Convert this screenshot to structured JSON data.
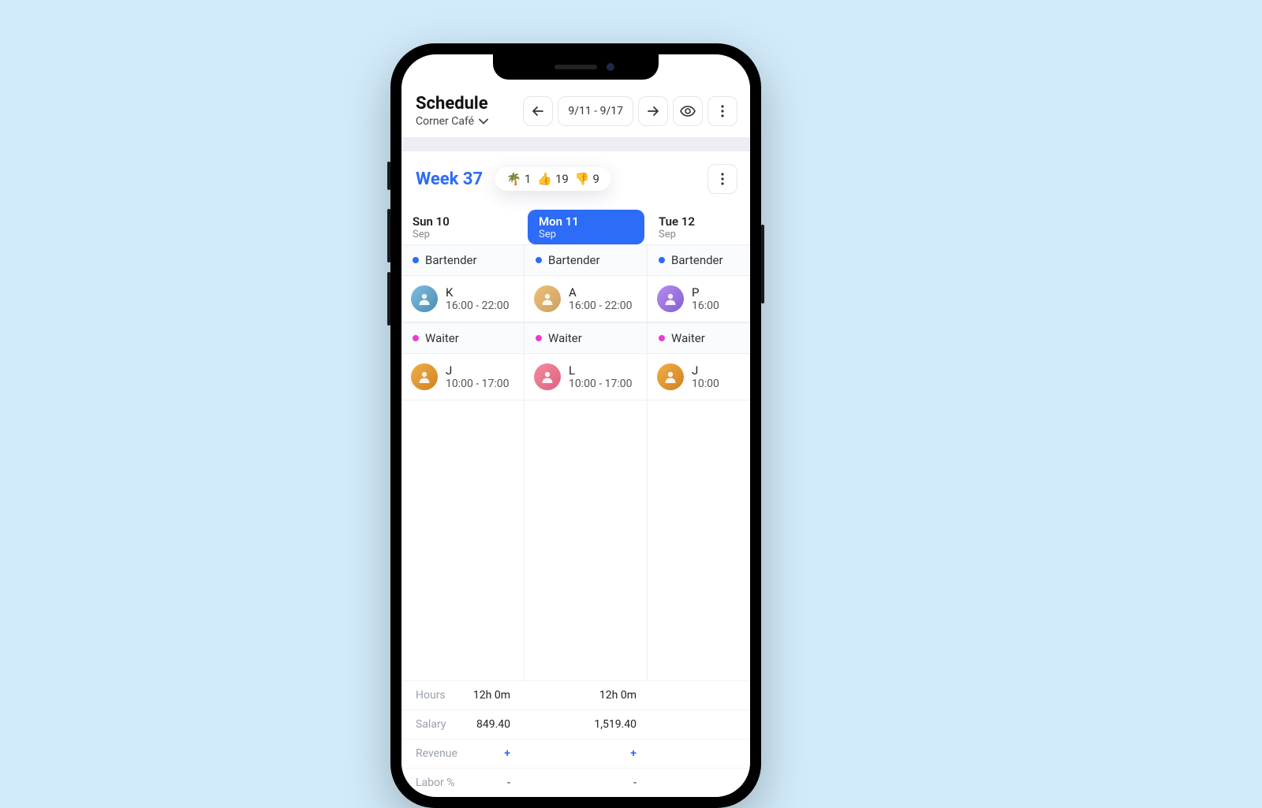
{
  "header": {
    "title": "Schedule",
    "location": "Corner Café",
    "date_range": "9/11 - 9/17"
  },
  "week": {
    "label": "Week 37",
    "counts": {
      "vacation_icon": "🌴",
      "vacation": "1",
      "up_icon": "👍",
      "up": "19",
      "down_icon": "👎",
      "down": "9"
    }
  },
  "days": [
    {
      "label": "Sun 10",
      "month": "Sep",
      "active": false
    },
    {
      "label": "Mon 11",
      "month": "Sep",
      "active": true
    },
    {
      "label": "Tue 12",
      "month": "Sep",
      "active": false
    }
  ],
  "roles": {
    "bartender": "Bartender",
    "waiter": "Waiter"
  },
  "shifts": {
    "bartender": [
      {
        "name": "K",
        "time": "16:00 - 22:00"
      },
      {
        "name": "A",
        "time": "16:00 - 22:00"
      },
      {
        "name": "P",
        "time": "16:00"
      }
    ],
    "waiter": [
      {
        "name": "J",
        "time": "10:00 - 17:00"
      },
      {
        "name": "L",
        "time": "10:00 - 17:00"
      },
      {
        "name": "J",
        "time": "10:00"
      }
    ]
  },
  "summary": {
    "labels": {
      "hours": "Hours",
      "salary": "Salary",
      "revenue": "Revenue",
      "labor": "Labor %"
    },
    "cols": [
      {
        "hours": "12h 0m",
        "salary": "849.40",
        "revenue": "+",
        "labor": "-"
      },
      {
        "hours": "12h 0m",
        "salary": "1,519.40",
        "revenue": "+",
        "labor": "-"
      }
    ]
  }
}
